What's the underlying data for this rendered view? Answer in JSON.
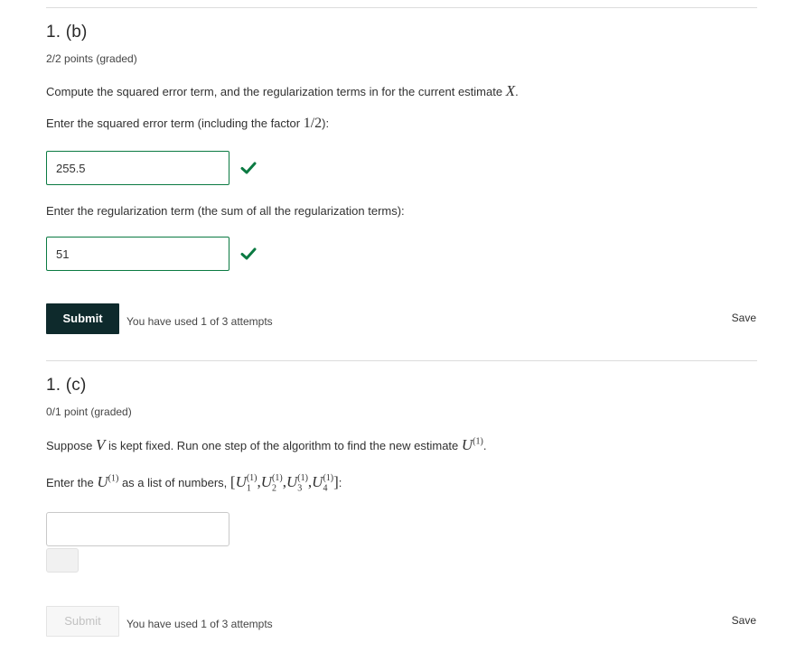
{
  "part_b": {
    "title": "1. (b)",
    "points": "2/2 points (graded)",
    "prompt_text": "Compute the squared error term, and the regularization terms in for the current estimate ",
    "prompt_math": "X",
    "prompt_end": ".",
    "q1_label": "Enter the squared error term (including the factor ",
    "q1_math": "1/2",
    "q1_end": "):",
    "q1_value": "255.5",
    "q2_label": "Enter the regularization term (the sum of all the regularization terms):",
    "q2_value": "51",
    "submit_label": "Submit",
    "attempts": "You have used 1 of 3 attempts",
    "save_label": "Save",
    "correct_color": "#0b7a42"
  },
  "part_c": {
    "title": "1. (c)",
    "points": "0/1 point (graded)",
    "prompt_start": "Suppose ",
    "prompt_math_v": "V",
    "prompt_mid": " is kept fixed. Run one step of the algorithm to find the new estimate ",
    "prompt_math_u": "U",
    "sup_1": "(1)",
    "prompt_end": ".",
    "q_label_start": "Enter the ",
    "q_label_mid": " as a list of numbers, ",
    "q_label_end": ":",
    "sub_1": "1",
    "sub_2": "2",
    "sub_3": "3",
    "sub_4": "4",
    "bracket_open": "[",
    "bracket_close": "]",
    "comma": ",",
    "input_value": "",
    "submit_label": "Submit",
    "attempts": "You have used 1 of 3 attempts",
    "save_label": "Save"
  }
}
